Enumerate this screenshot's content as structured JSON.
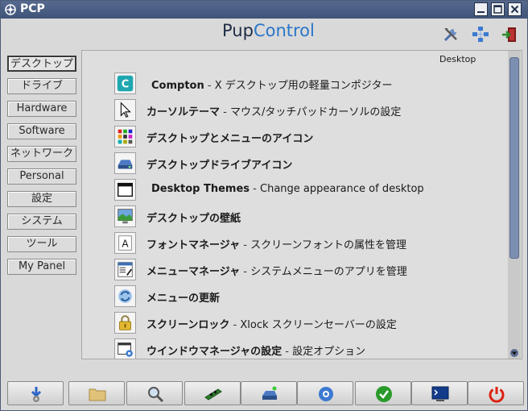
{
  "window": {
    "title": "PCP"
  },
  "header": {
    "brand_part1": "Pup",
    "brand_part2": "Control",
    "icons": [
      "tools-icon",
      "network-icon",
      "exit-icon"
    ]
  },
  "sidebar": {
    "items": [
      {
        "label": "デスクトップ",
        "active": true
      },
      {
        "label": "ドライブ"
      },
      {
        "label": "Hardware"
      },
      {
        "label": "Software"
      },
      {
        "label": "ネットワーク"
      },
      {
        "label": "Personal"
      },
      {
        "label": "設定"
      },
      {
        "label": "システム"
      },
      {
        "label": "ツール"
      },
      {
        "label": "My Panel"
      }
    ]
  },
  "main": {
    "section_title": "Desktop",
    "items": [
      {
        "name": "Compton",
        "desc": "X デスクトップ用の軽量コンポジター",
        "icon": "compton-icon"
      },
      {
        "name": "カーソルテーマ",
        "desc": "マウス/タッチパッドカーソルの設定",
        "icon": "cursor-icon"
      },
      {
        "name": "デスクトップとメニューのアイコン",
        "desc": "",
        "icon": "icon-grid-icon"
      },
      {
        "name": "デスクトップドライブアイコン",
        "desc": "",
        "icon": "drive-icon"
      },
      {
        "name": "Desktop Themes",
        "desc": "Change appearance of desktop",
        "icon": "window-theme-icon"
      },
      {
        "name": "デスクトップの壁紙",
        "desc": "",
        "icon": "wallpaper-icon"
      },
      {
        "name": "フォントマネージャ",
        "desc": "スクリーンフォントの属性を管理",
        "icon": "font-icon"
      },
      {
        "name": "メニューマネージャ",
        "desc": "システムメニューのアプリを管理",
        "icon": "menu-manager-icon"
      },
      {
        "name": "メニューの更新",
        "desc": "",
        "icon": "refresh-icon"
      },
      {
        "name": "スクリーンロック",
        "desc": "Xlock スクリーンセーバーの設定",
        "icon": "lock-icon"
      },
      {
        "name": "ウインドウマネージャの設定",
        "desc": "設定オプション",
        "icon": "window-settings-icon"
      }
    ]
  },
  "bottom_bar": {
    "buttons": [
      "install-icon",
      "folder-icon",
      "search-icon",
      "memory-icon",
      "drive-mount-icon",
      "settings-icon",
      "check-icon",
      "terminal-icon",
      "power-icon"
    ]
  },
  "colors": {
    "titlebar": "#4b5f83",
    "brand_accent": "#2a76c9",
    "scrollbar_thumb": "#7d8fb1"
  }
}
